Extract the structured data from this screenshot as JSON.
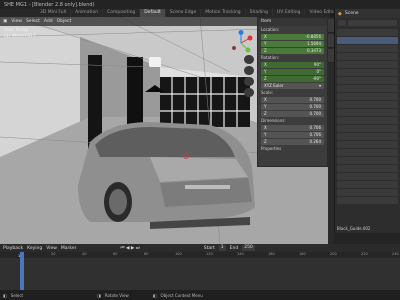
{
  "window": {
    "title": "SHE MG1 - [Blender 2.8 only].blend)"
  },
  "tabs": [
    "3D Mini Full",
    "Animation",
    "Compositing",
    "Default",
    "Scene Edge",
    "Motion Tracking",
    "Shading",
    "UV Editing",
    "Video Editing"
  ],
  "active_tab": "Default",
  "viewport": {
    "mode": "User Persp",
    "object_label": "(1) Wheel.017",
    "menu": [
      "View",
      "Select",
      "Add",
      "Object"
    ]
  },
  "transform_panel": {
    "title": "Item",
    "location_label": "Location:",
    "location": [
      {
        "axis": "X",
        "value": "-0.8856"
      },
      {
        "axis": "Y",
        "value": "1.5694"
      },
      {
        "axis": "Z",
        "value": "0.3473"
      }
    ],
    "rotation_label": "Rotation:",
    "rotation": [
      {
        "axis": "X",
        "value": "90°"
      },
      {
        "axis": "Y",
        "value": "0°"
      },
      {
        "axis": "Z",
        "value": "-90°"
      }
    ],
    "rotation_mode": "XYZ Euler",
    "scale_label": "Scale:",
    "scale": [
      {
        "axis": "X",
        "value": "0.700"
      },
      {
        "axis": "Y",
        "value": "0.700"
      },
      {
        "axis": "Z",
        "value": "0.700"
      }
    ],
    "dimensions_label": "Dimensions:",
    "dimensions": [
      {
        "axis": "X",
        "value": "0.706"
      },
      {
        "axis": "Y",
        "value": "0.706"
      },
      {
        "axis": "Z",
        "value": "0.264"
      }
    ],
    "properties_label": "Properties"
  },
  "outliner": {
    "title": "Scene",
    "footer": "Black_Guide.002"
  },
  "timeline": {
    "menu": [
      "Playback",
      "Keying",
      "View",
      "Marker"
    ],
    "start_label": "Start",
    "start": "1",
    "end_label": "End",
    "end": "250",
    "current_frame": "1",
    "ruler": [
      "0",
      "20",
      "40",
      "60",
      "80",
      "100",
      "120",
      "140",
      "160",
      "180",
      "200",
      "220",
      "240"
    ]
  },
  "status": {
    "left": "Select",
    "middle": "Rotate View",
    "right": "Object Context Menu"
  },
  "colors": {
    "accent": "#4a7a3a",
    "selection": "#f29e3a"
  }
}
